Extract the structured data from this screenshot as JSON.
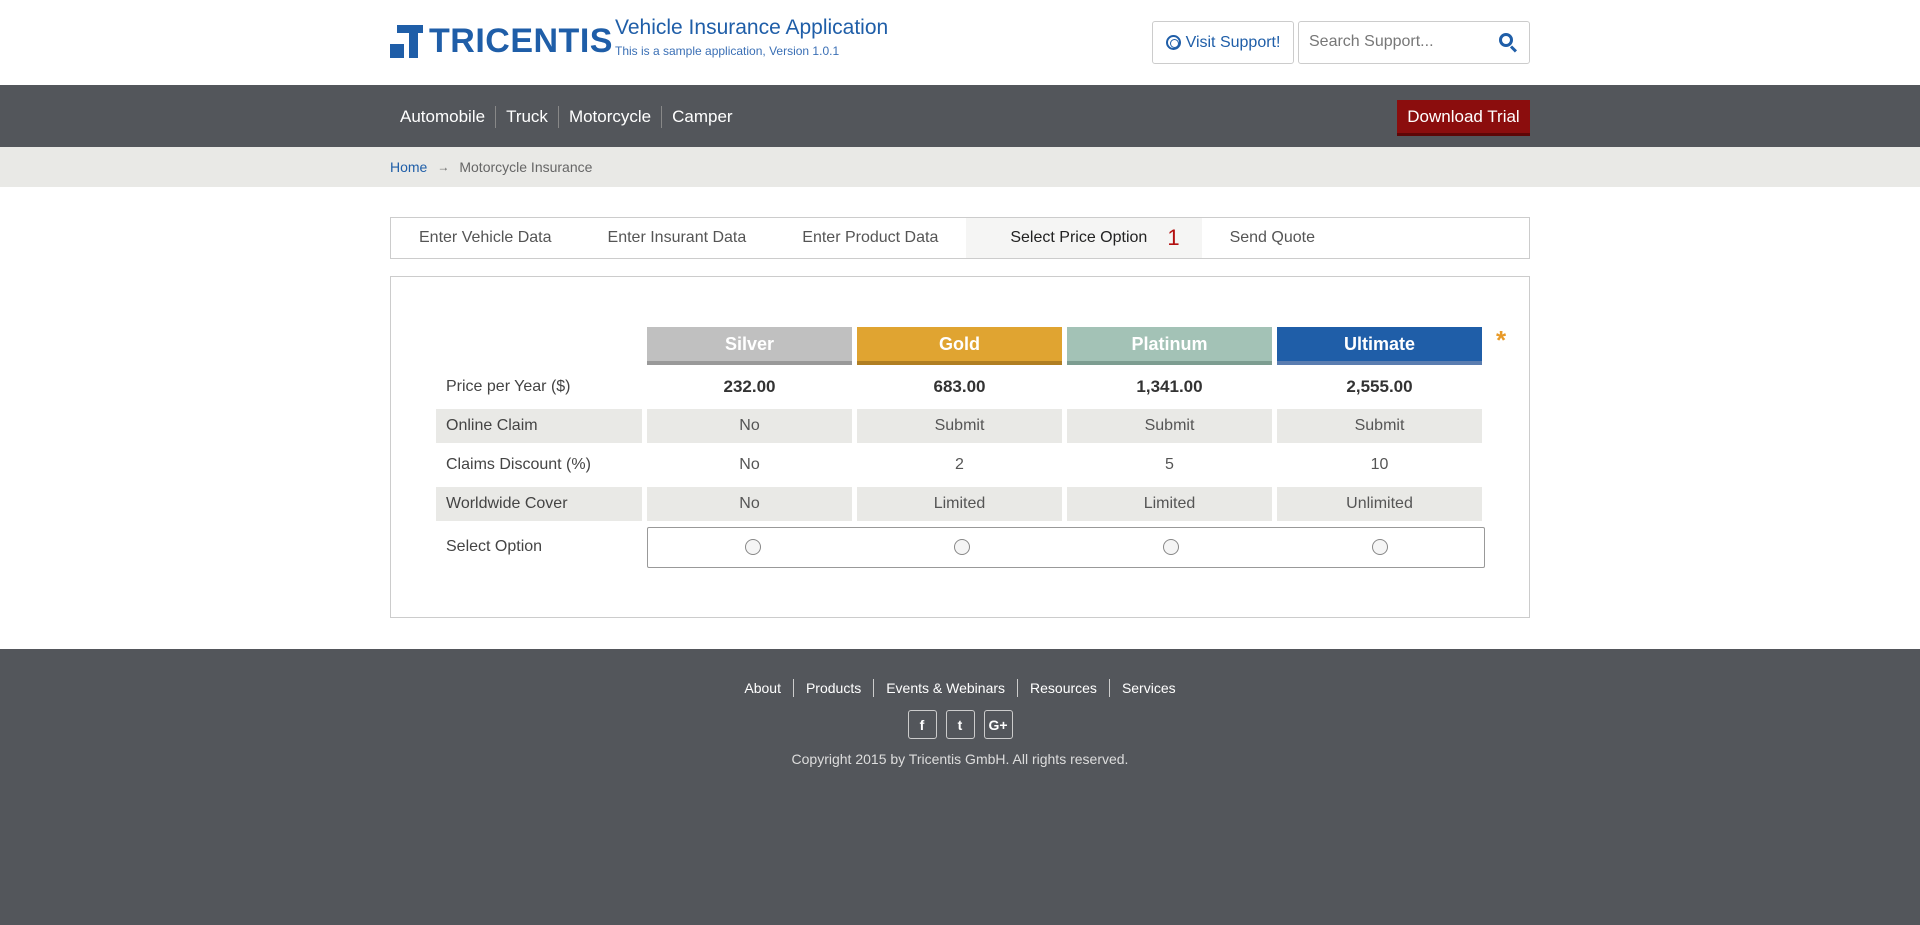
{
  "header": {
    "logo_text": "TRICENTIS",
    "app_title": "Vehicle Insurance Application",
    "app_subtitle": "This is a sample application, Version 1.0.1",
    "support_label": "Visit Support!",
    "search_placeholder": "Search Support..."
  },
  "nav": {
    "items": [
      {
        "label": "Automobile"
      },
      {
        "label": "Truck"
      },
      {
        "label": "Motorcycle"
      },
      {
        "label": "Camper"
      }
    ],
    "download_label": "Download Trial"
  },
  "breadcrumb": {
    "home": "Home",
    "arrow": "→",
    "current": "Motorcycle Insurance"
  },
  "wizard": {
    "tabs": [
      {
        "label": "Enter Vehicle Data"
      },
      {
        "label": "Enter Insurant Data"
      },
      {
        "label": "Enter Product Data"
      },
      {
        "label": "Select Price Option",
        "count": "1"
      },
      {
        "label": "Send Quote"
      }
    ]
  },
  "plans": {
    "names": [
      "Silver",
      "Gold",
      "Platinum",
      "Ultimate"
    ],
    "asterisk": "*",
    "rows": [
      {
        "label": "Price per Year ($)",
        "values": [
          "232.00",
          "683.00",
          "1,341.00",
          "2,555.00"
        ]
      },
      {
        "label": "Online Claim",
        "values": [
          "No",
          "Submit",
          "Submit",
          "Submit"
        ]
      },
      {
        "label": "Claims Discount (%)",
        "values": [
          "No",
          "2",
          "5",
          "10"
        ]
      },
      {
        "label": "Worldwide Cover",
        "values": [
          "No",
          "Limited",
          "Limited",
          "Unlimited"
        ]
      }
    ],
    "select_label": "Select Option"
  },
  "footer": {
    "links": [
      {
        "label": "About"
      },
      {
        "label": "Products"
      },
      {
        "label": "Events & Webinars"
      },
      {
        "label": "Resources"
      },
      {
        "label": "Services"
      }
    ],
    "social": [
      {
        "name": "facebook-icon",
        "glyph": "f"
      },
      {
        "name": "twitter-icon",
        "glyph": "t"
      },
      {
        "name": "google-plus-icon",
        "glyph": "G+"
      }
    ],
    "copyright": "Copyright 2015 by Tricentis GmbH. All rights reserved."
  }
}
